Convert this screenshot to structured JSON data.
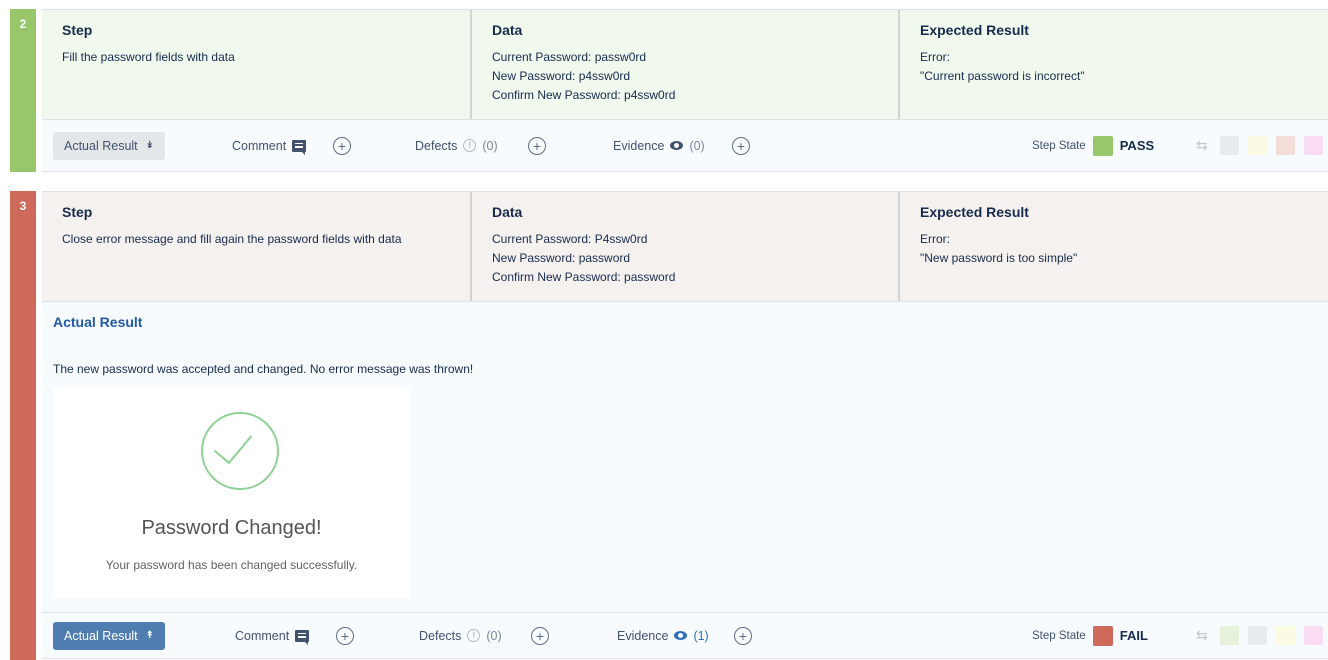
{
  "colors": {
    "pass": "#97c76a",
    "fail": "#cd6a5a",
    "pass_bg": "#f1f8ee",
    "fail_bg": "#f5f1ef",
    "actual_title": "#2158a8"
  },
  "steps": [
    {
      "number": "2",
      "step_header": "Step",
      "step_text": "Fill the password fields with data",
      "data_header": "Data",
      "data_lines": [
        "Current Password: passw0rd",
        "New Password: p4ssw0rd",
        "Confirm New Password: p4ssw0rd"
      ],
      "expected_header": "Expected Result",
      "expected_lines": [
        "Error:",
        "\"Current password is incorrect\""
      ],
      "actual_result_button": "Actual Result",
      "actual_result_expanded": false,
      "comment_label": "Comment",
      "defects_label": "Defects",
      "defects_count": "(0)",
      "evidence_label": "Evidence",
      "evidence_count": "(0)",
      "step_state_label": "Step State",
      "step_state_value": "PASS"
    },
    {
      "number": "3",
      "step_header": "Step",
      "step_text": "Close error message and fill again the password fields with data",
      "data_header": "Data",
      "data_lines": [
        "Current Password: P4ssw0rd",
        "New Password: password",
        "Confirm New Password: password"
      ],
      "expected_header": "Expected Result",
      "expected_lines": [
        "Error:",
        "\"New password is too simple\""
      ],
      "actual_result": {
        "title": "Actual Result",
        "text": "The new password was accepted and changed. No error message was thrown!",
        "card_title": "Password Changed!",
        "card_subtitle": "Your password has been changed successfully."
      },
      "actual_result_button": "Actual Result",
      "actual_result_expanded": true,
      "comment_label": "Comment",
      "defects_label": "Defects",
      "defects_count": "(0)",
      "evidence_label": "Evidence",
      "evidence_count": "(1)",
      "step_state_label": "Step State",
      "step_state_value": "FAIL"
    }
  ]
}
